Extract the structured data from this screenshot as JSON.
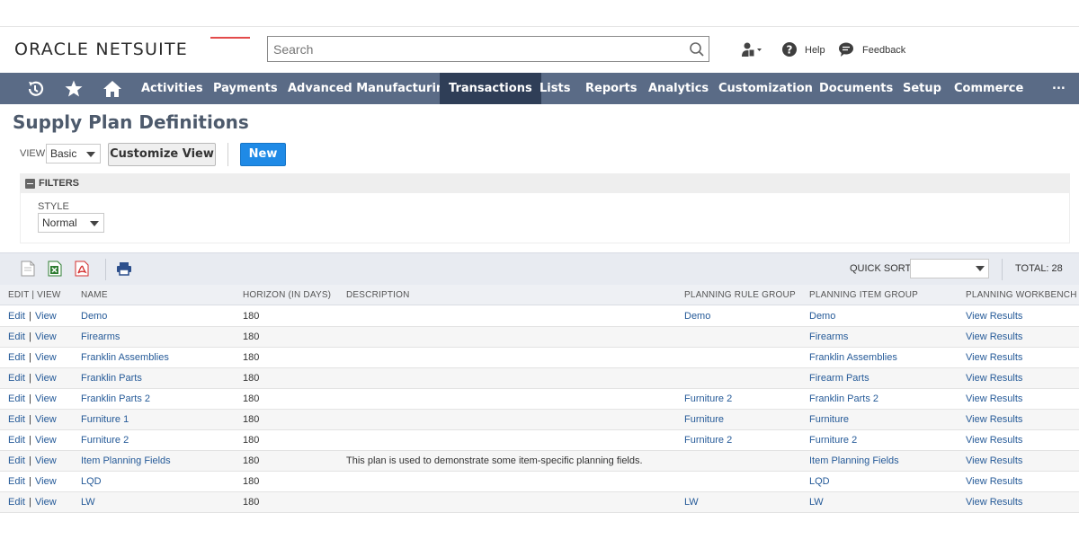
{
  "header": {
    "logo_text": "ORACLE NETSUITE",
    "search_placeholder": "Search",
    "help_label": "Help",
    "feedback_label": "Feedback"
  },
  "nav": {
    "items": [
      {
        "label": "Activities"
      },
      {
        "label": "Payments"
      },
      {
        "label": "Advanced Manufacturing"
      },
      {
        "label": "Transactions",
        "active": true
      },
      {
        "label": "Lists"
      },
      {
        "label": "Reports"
      },
      {
        "label": "Analytics"
      },
      {
        "label": "Customization"
      },
      {
        "label": "Documents"
      },
      {
        "label": "Setup"
      },
      {
        "label": "Commerce"
      }
    ],
    "more_label": "..."
  },
  "page": {
    "title": "Supply Plan Definitions",
    "view_label": "VIEW",
    "view_value": "Basic",
    "customize_view_label": "Customize View",
    "new_label": "New"
  },
  "filters": {
    "header": "FILTERS",
    "style_label": "STYLE",
    "style_value": "Normal"
  },
  "toolbar": {
    "quick_sort_label": "QUICK SORT",
    "quick_sort_value": "",
    "total_label": "TOTAL: 28"
  },
  "table": {
    "columns": [
      "EDIT | VIEW",
      "NAME",
      "HORIZON (IN DAYS)",
      "DESCRIPTION",
      "PLANNING RULE GROUP",
      "PLANNING ITEM GROUP",
      "PLANNING WORKBENCH"
    ],
    "edit_label": "Edit",
    "view_label": "View",
    "rows": [
      {
        "name": "Demo",
        "horizon": "180",
        "description": "",
        "rule_group": "Demo",
        "item_group": "Demo",
        "workbench": "View Results"
      },
      {
        "name": "Firearms",
        "horizon": "180",
        "description": "",
        "rule_group": "",
        "item_group": "Firearms",
        "workbench": "View Results"
      },
      {
        "name": "Franklin Assemblies",
        "horizon": "180",
        "description": "",
        "rule_group": "",
        "item_group": "Franklin Assemblies",
        "workbench": "View Results"
      },
      {
        "name": "Franklin Parts",
        "horizon": "180",
        "description": "",
        "rule_group": "",
        "item_group": "Firearm Parts",
        "workbench": "View Results"
      },
      {
        "name": "Franklin Parts 2",
        "horizon": "180",
        "description": "",
        "rule_group": "Furniture 2",
        "item_group": "Franklin Parts 2",
        "workbench": "View Results"
      },
      {
        "name": "Furniture 1",
        "horizon": "180",
        "description": "",
        "rule_group": "Furniture",
        "item_group": "Furniture",
        "workbench": "View Results"
      },
      {
        "name": "Furniture 2",
        "horizon": "180",
        "description": "",
        "rule_group": "Furniture 2",
        "item_group": "Furniture 2",
        "workbench": "View Results"
      },
      {
        "name": "Item Planning Fields",
        "horizon": "180",
        "description": "This plan is used to demonstrate some item-specific planning fields.",
        "rule_group": "",
        "item_group": "Item Planning Fields",
        "workbench": "View Results"
      },
      {
        "name": "LQD",
        "horizon": "180",
        "description": "",
        "rule_group": "",
        "item_group": "LQD",
        "workbench": "View Results"
      },
      {
        "name": "LW",
        "horizon": "180",
        "description": "",
        "rule_group": "LW",
        "item_group": "LW",
        "workbench": "View Results"
      }
    ]
  },
  "colors": {
    "nav_bg": "#5a6b86",
    "nav_active": "#2f3e57",
    "link": "#255a98",
    "primary_button": "#1f8ae6"
  }
}
